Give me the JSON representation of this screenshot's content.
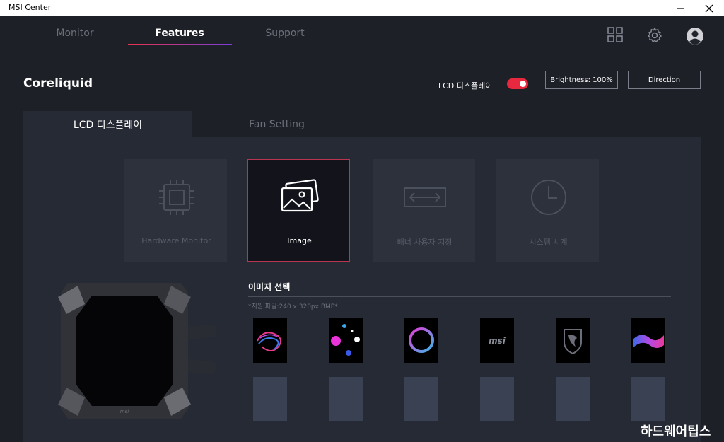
{
  "window": {
    "title": "MSI Center"
  },
  "nav": {
    "tabs": [
      "Monitor",
      "Features",
      "Support"
    ],
    "active": "Features"
  },
  "header": {
    "device": "Coreliquid",
    "lcd_toggle_label": "LCD 디스플레이",
    "lcd_toggle_on": true,
    "brightness_button": "Brightness: 100%",
    "direction_button": "Direction"
  },
  "subtabs": [
    "LCD 디스플레이",
    "Fan Setting"
  ],
  "modes": [
    {
      "label": "Hardware Monitor",
      "icon": "cpu-chip-icon"
    },
    {
      "label": "Image",
      "icon": "image-gallery-icon"
    },
    {
      "label": "배너 사용자 지정",
      "icon": "banner-arrows-icon"
    },
    {
      "label": "시스템 시계",
      "icon": "clock-icon"
    }
  ],
  "image_select": {
    "title": "이미지 선택",
    "note": "*지원 파일:240 x 320px BMP*",
    "thumbnails": [
      "swirl-neon-icon",
      "colored-dots-icon",
      "neon-ring-icon",
      "msi-logo-icon",
      "msi-dragon-shield-icon",
      "wave-gradient-icon"
    ]
  },
  "watermark": "하드웨어팁스",
  "colors": {
    "accent_red": "#e8283e",
    "accent_purple": "#7a3fd9",
    "background": "#1e2028",
    "panel": "#262a34"
  }
}
